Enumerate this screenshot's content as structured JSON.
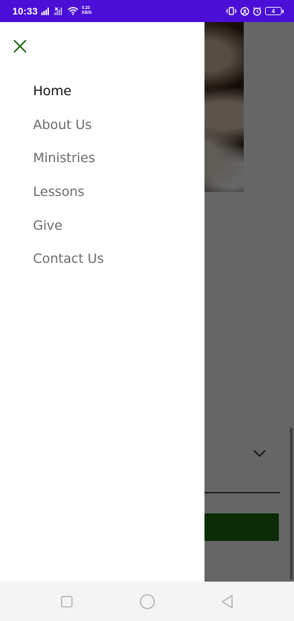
{
  "status_bar": {
    "time": "10:33",
    "net_speed_value": "0.23",
    "net_speed_unit": "KB/S",
    "battery_level": "4",
    "color": "#4a0fd6"
  },
  "drawer": {
    "close_icon": "close-icon",
    "accent_color": "#1f6b12",
    "menu": [
      {
        "label": "Home",
        "active": true
      },
      {
        "label": "About Us",
        "active": false
      },
      {
        "label": "Ministries",
        "active": false
      },
      {
        "label": "Lessons",
        "active": false
      },
      {
        "label": "Give",
        "active": false
      },
      {
        "label": "Contact Us",
        "active": false
      }
    ]
  },
  "background": {
    "button_color": "#1f6b12",
    "dropdown_icon": "chevron-down-icon"
  },
  "nav_bar": {
    "recents_icon": "square-icon",
    "home_icon": "circle-icon",
    "back_icon": "triangle-back-icon"
  }
}
